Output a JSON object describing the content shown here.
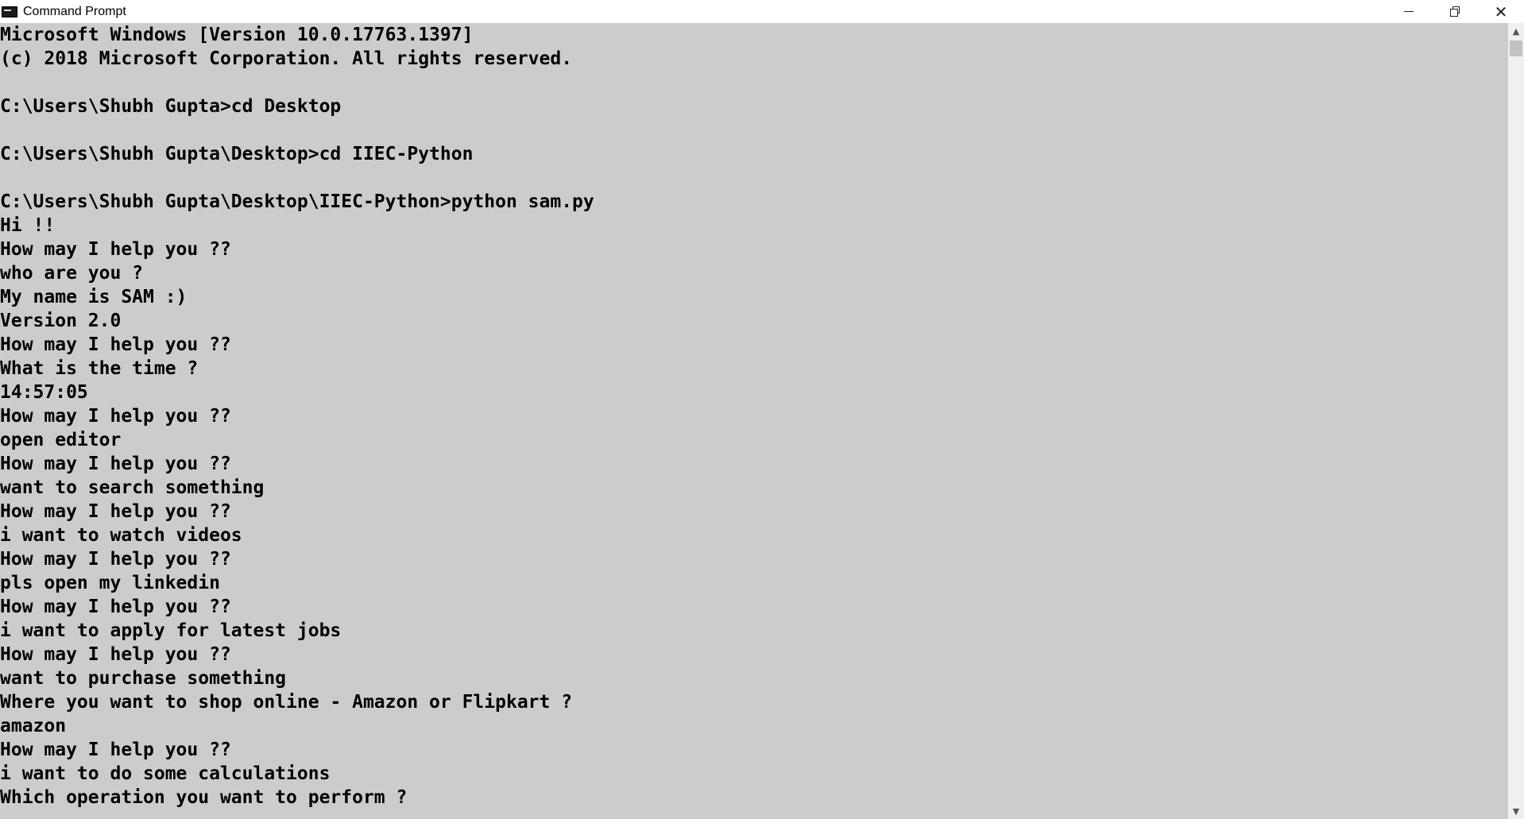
{
  "window": {
    "title": "Command Prompt"
  },
  "console": {
    "lines": [
      "Microsoft Windows [Version 10.0.17763.1397]",
      "(c) 2018 Microsoft Corporation. All rights reserved.",
      "",
      "C:\\Users\\Shubh Gupta>cd Desktop",
      "",
      "C:\\Users\\Shubh Gupta\\Desktop>cd IIEC-Python",
      "",
      "C:\\Users\\Shubh Gupta\\Desktop\\IIEC-Python>python sam.py",
      "Hi !!",
      "How may I help you ??",
      "who are you ?",
      "My name is SAM :)",
      "Version 2.0",
      "How may I help you ??",
      "What is the time ?",
      "14:57:05",
      "How may I help you ??",
      "open editor",
      "How may I help you ??",
      "want to search something",
      "How may I help you ??",
      "i want to watch videos",
      "How may I help you ??",
      "pls open my linkedin",
      "How may I help you ??",
      "i want to apply for latest jobs",
      "How may I help you ??",
      "want to purchase something",
      "Where you want to shop online - Amazon or Flipkart ?",
      "amazon",
      "How may I help you ??",
      "i want to do some calculations",
      "Which operation you want to perform ?"
    ]
  },
  "icons": {
    "app": "cmd-app-icon",
    "minimize": "minimize-icon",
    "maximize": "restore-icon",
    "close": "close-icon",
    "scroll_up": "scroll-up-arrow-icon",
    "scroll_down": "scroll-down-arrow-icon"
  },
  "colors": {
    "console_bg": "#cccccc",
    "console_fg": "#000000",
    "titlebar_bg": "#ffffff"
  }
}
